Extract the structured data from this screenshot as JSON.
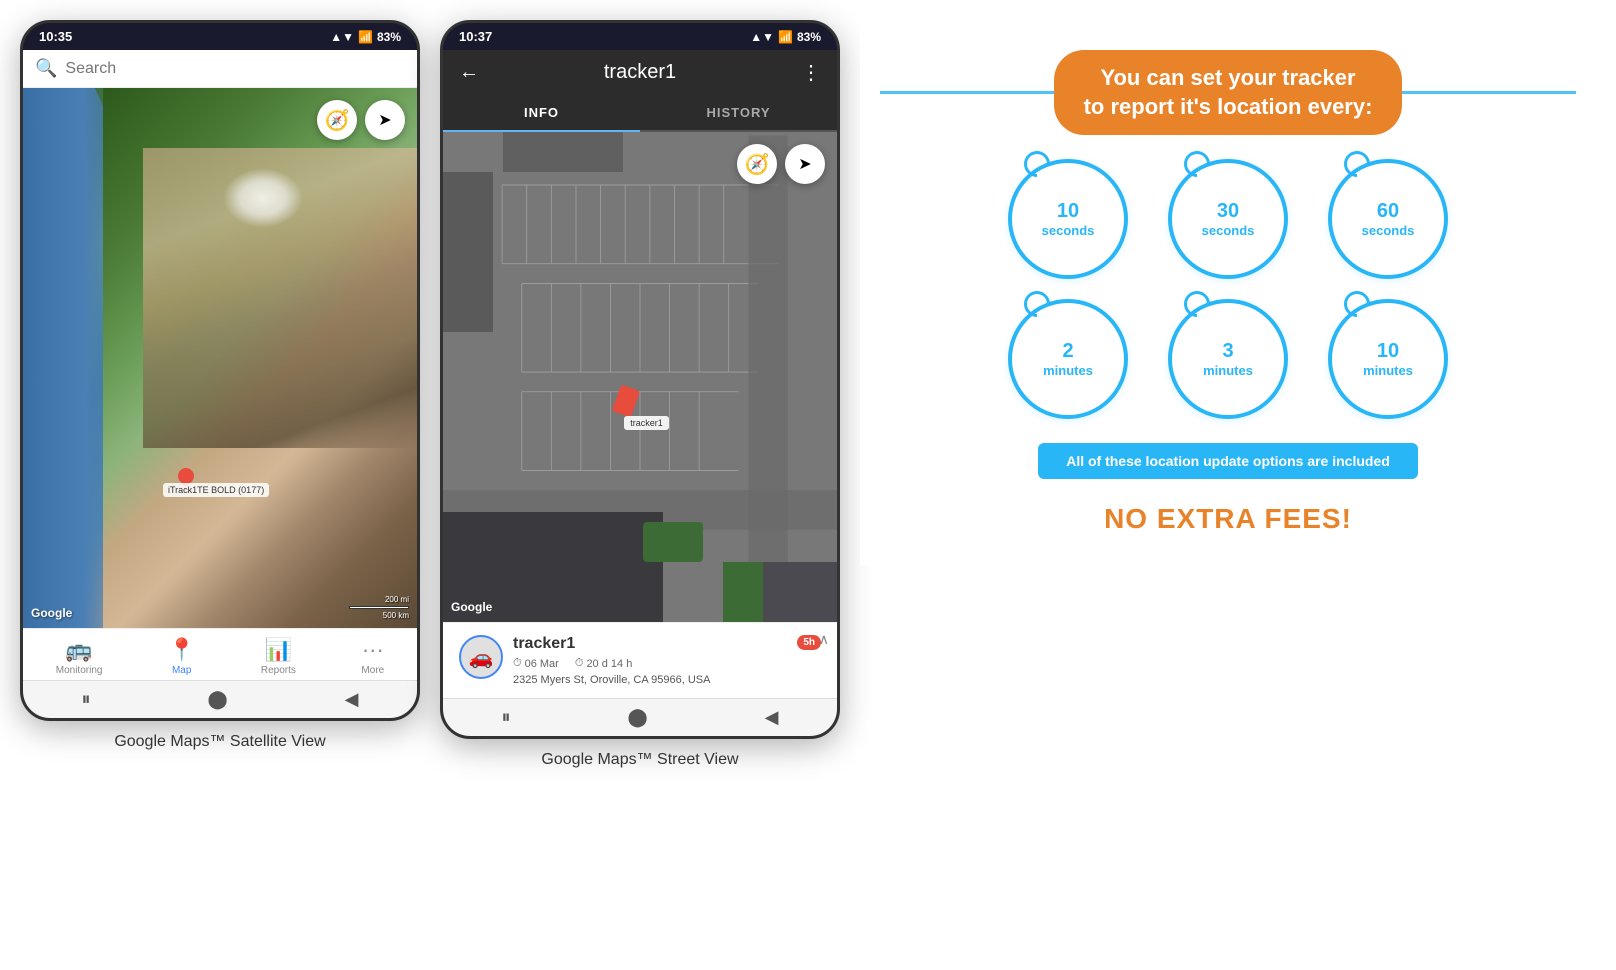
{
  "phone1": {
    "status_bar": {
      "time": "10:35",
      "signal": "▲▼",
      "wifi": "WiFi",
      "battery": "83%"
    },
    "search": {
      "placeholder": "Search"
    },
    "map": {
      "google_logo": "Google",
      "scale_top": "200 mi",
      "scale_bottom": "500 km",
      "location_label": "iTrack1TE BOLD (0177)"
    },
    "nav_items": [
      {
        "icon": "🚌",
        "label": "Monitoring",
        "active": false
      },
      {
        "icon": "📍",
        "label": "Map",
        "active": true
      },
      {
        "icon": "📊",
        "label": "Reports",
        "active": false
      },
      {
        "icon": "···",
        "label": "More",
        "active": false
      }
    ],
    "caption": "Google Maps™ Satellite View"
  },
  "phone2": {
    "status_bar": {
      "time": "10:37",
      "battery": "83%"
    },
    "header": {
      "back_icon": "←",
      "title": "tracker1",
      "more_icon": "⋮"
    },
    "tabs": [
      {
        "label": "INFO",
        "active": true
      },
      {
        "label": "HISTORY",
        "active": false
      }
    ],
    "map": {
      "google_logo": "Google",
      "car_label": "tracker1"
    },
    "tracker_info": {
      "name": "tracker1",
      "date": "06 Mar",
      "duration": "20 d 14 h",
      "address": "2325 Myers St, Oroville, CA 95966, USA",
      "time_badge": "5h"
    },
    "caption": "Google Maps™ Street View"
  },
  "info_panel": {
    "headline": "You can set your tracker\nto report it's location every:",
    "circles": [
      {
        "number": "10",
        "unit": "seconds"
      },
      {
        "number": "30",
        "unit": "seconds"
      },
      {
        "number": "60",
        "unit": "seconds"
      },
      {
        "number": "2",
        "unit": "minutes"
      },
      {
        "number": "3",
        "unit": "minutes"
      },
      {
        "number": "10",
        "unit": "minutes"
      }
    ],
    "banner_text": "All of these location update options are included",
    "no_fees_text": "NO EXTRA FEES!",
    "accent_color": "#e8832a",
    "blue_color": "#29b6f6"
  }
}
